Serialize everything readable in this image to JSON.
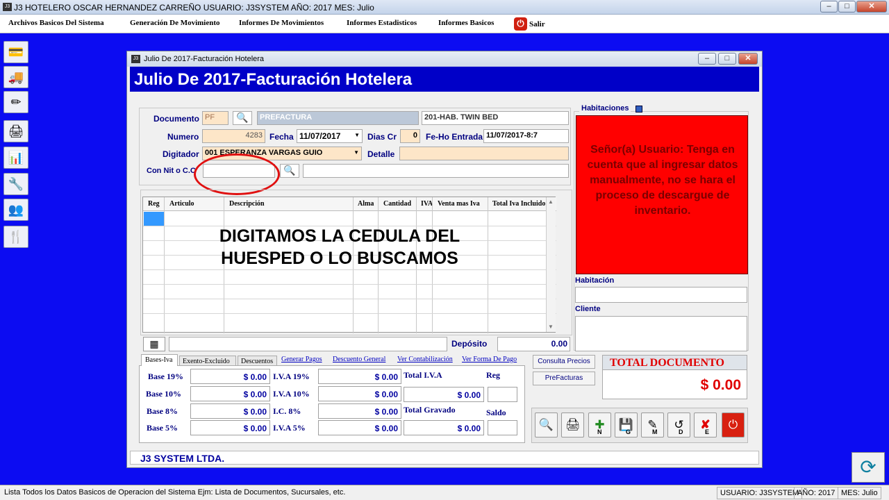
{
  "app": {
    "title": "J3 HOTELERO OSCAR HERNANDEZ CARREÑO USUARIO: J3SYSTEM AÑO: 2017 MES: Julio",
    "icon_text": "J3"
  },
  "menu": {
    "items": [
      "Archivos Basicos Del Sistema",
      "Generación De Movimiento",
      "Informes De Movimientos",
      "Informes Estadisticos",
      "Informes Basicos"
    ],
    "exit_label": "Salir"
  },
  "window": {
    "title": "Julio De 2017-Facturación Hotelera",
    "header": "Julio De 2017-Facturación Hotelera",
    "icon_text": "J3"
  },
  "form": {
    "documento_label": "Documento",
    "documento_code": "PF",
    "documento_name": "PREFACTURA",
    "habitacion_tipo": "201-HAB. TWIN BED",
    "numero_label": "Numero",
    "numero": "4283",
    "fecha_label": "Fecha",
    "fecha": "11/07/2017",
    "dias_label": "Dias Cr",
    "dias": "0",
    "feho_label": "Fe-Ho Entrada",
    "feho": "11/07/2017-8:7",
    "digitador_label": "Digitador",
    "digitador": "001   ESPERANZA VARGAS GUIO",
    "detalle_label": "Detalle",
    "detalle": "",
    "nit_label": "Con Nit o C.C",
    "nit": "",
    "nit_name": ""
  },
  "grid": {
    "columns": [
      "Reg",
      "Articulo",
      "Descripción",
      "Alma",
      "Cantidad",
      "IVA",
      "Venta mas Iva",
      "Total Iva Incluido"
    ]
  },
  "annotation": "DIGITAMOS LA CEDULA DEL HUESPED O LO BUSCAMOS",
  "deposito": {
    "label": "Depósito",
    "value": "0.00"
  },
  "tabs": [
    "Bases-Iva",
    "Exento-Excluido",
    "Descuentos",
    "Generar Pagos",
    "Descuento General",
    "Ver Contabilización",
    "Ver Forma De Pago"
  ],
  "bases": {
    "base19_label": "Base 19%",
    "base19": "$ 0.00",
    "base10_label": "Base 10%",
    "base10": "$ 0.00",
    "base8_label": "Base 8%",
    "base8": "$ 0.00",
    "base5_label": "Base 5%",
    "base5": "$ 0.00",
    "iva19_label": "I.V.A 19%",
    "iva19": "$ 0.00",
    "iva10_label": "I.V.A 10%",
    "iva10": "$ 0.00",
    "ic8_label": "I.C. 8%",
    "ic8": "$ 0.00",
    "iva5_label": "I.V.A 5%",
    "iva5": "$ 0.00",
    "total_iva_label": "Total I.V.A",
    "total_iva": "$ 0.00",
    "total_gravado_label": "Total Gravado",
    "total_gravado": "$ 0.00",
    "reg_label": "Reg",
    "saldo_label": "Saldo"
  },
  "buttons": {
    "consulta_precios": "Consulta Precios",
    "prefacturas": "PreFacturas"
  },
  "total": {
    "label": "TOTAL DOCUMENTO",
    "value": "$ 0.00"
  },
  "right_panel": {
    "habitaciones_label": "Habitaciones",
    "warning": "Señor(a) Usuario: Tenga en cuenta que al ingresar datos manualmente, no se hara el proceso de descargue de inventario.",
    "habitacion_label": "Habitación",
    "cliente_label": "Cliente"
  },
  "action_letters": [
    "N",
    "G",
    "M",
    "D",
    "E"
  ],
  "footer": "J3 SYSTEM LTDA.",
  "status": {
    "message": "Lista Todos los Datos Basicos de Operacion del Sistema Ejm: Lista de Documentos, Sucursales, etc.",
    "usuario": "USUARIO: J3SYSTEM",
    "anio": "AÑO: 2017",
    "mes": "MES: Julio"
  },
  "colors": {
    "desktop": "#0c0cf2",
    "header": "#0000c8",
    "warning_bg": "#ff0000",
    "total_red": "#e00000"
  }
}
